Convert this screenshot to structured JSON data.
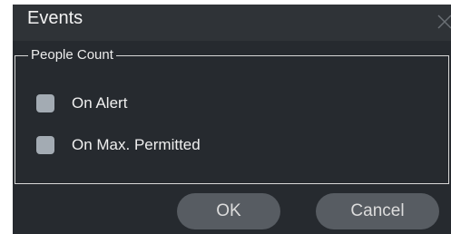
{
  "dialog": {
    "title": "Events",
    "close_icon": "close-icon",
    "group": {
      "legend": "People Count",
      "options": [
        {
          "label": "On Alert",
          "checked": false
        },
        {
          "label": "On Max. Permitted",
          "checked": false
        }
      ]
    },
    "buttons": {
      "ok_label": "OK",
      "cancel_label": "Cancel"
    }
  },
  "colors": {
    "dialog_background": "#262a2f",
    "titlebar_background": "#2f3337",
    "checkbox_fill": "#a3abb3",
    "button_background": "#575c62",
    "text": "#f0f0f0"
  }
}
